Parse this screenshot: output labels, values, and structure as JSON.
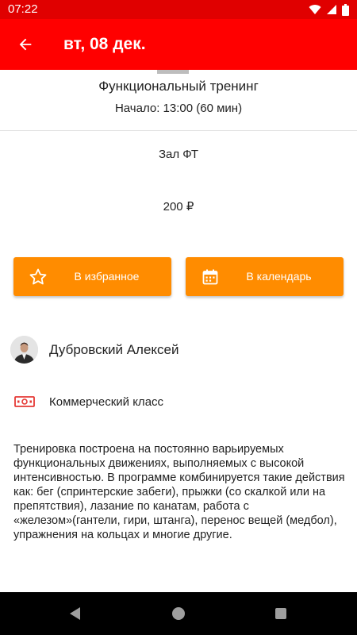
{
  "status_bar": {
    "time": "07:22",
    "icons": [
      "wifi-icon",
      "cellular-signal-icon",
      "battery-icon"
    ]
  },
  "app_bar": {
    "title": "вт, 08 дек.",
    "back_icon": "arrow-left-icon",
    "color": "#ff0000"
  },
  "class": {
    "title": "Функциональный тренинг",
    "start": "Начало: 13:00 (60 мин)",
    "hall": "Зал ФТ",
    "price": "200 ₽"
  },
  "actions": {
    "favorite_label": "В избранное",
    "favorite_icon": "star-outline-icon",
    "calendar_label": "В календарь",
    "calendar_icon": "calendar-icon",
    "color": "#ff8c00"
  },
  "trainer": {
    "name": "Дубровский Алексей"
  },
  "class_type": {
    "label": "Коммерческий класс",
    "icon": "money-icon",
    "icon_color": "#e53935"
  },
  "description": "Тренировка построена на постоянно варьируемых функциональных движениях, выполняемых с высокой интенсивностью. В программе комбинируется такие действия как: бег (спринтерские забеги), прыжки (со скалкой или на препятствия), лазание по канатам, работа с «железом»(гантели, гири, штанга), перенос вещей (медбол), упражнения на кольцах и многие другие."
}
